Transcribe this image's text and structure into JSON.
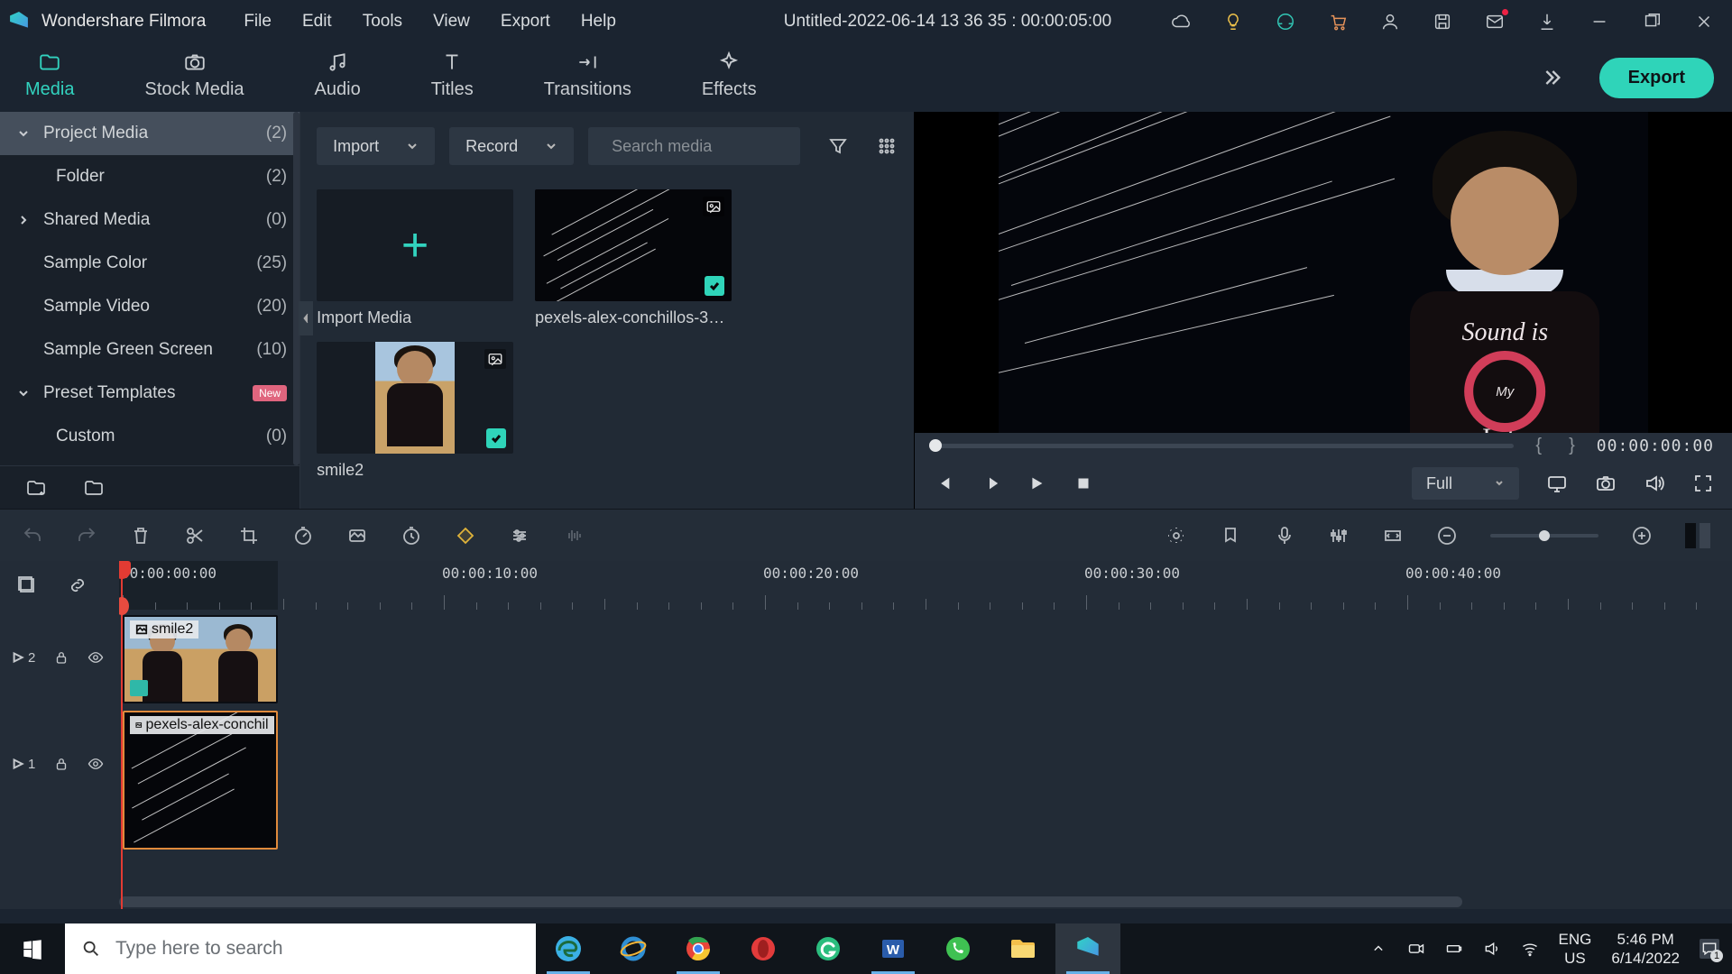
{
  "app": {
    "name": "Wondershare Filmora"
  },
  "menu": {
    "file": "File",
    "edit": "Edit",
    "tools": "Tools",
    "view": "View",
    "export": "Export",
    "help": "Help"
  },
  "title": "Untitled-2022-06-14 13 36 35 : 00:00:05:00",
  "modes": {
    "media": "Media",
    "stock": "Stock Media",
    "audio": "Audio",
    "titles": "Titles",
    "transitions": "Transitions",
    "effects": "Effects"
  },
  "export_btn": "Export",
  "sidebar": {
    "items": [
      {
        "label": "Project Media",
        "count": "(2)",
        "arrow": "down",
        "sel": true
      },
      {
        "label": "Folder",
        "count": "(2)",
        "indent": true
      },
      {
        "label": "Shared Media",
        "count": "(0)",
        "arrow": "right"
      },
      {
        "label": "Sample Color",
        "count": "(25)"
      },
      {
        "label": "Sample Video",
        "count": "(20)"
      },
      {
        "label": "Sample Green Screen",
        "count": "(10)"
      },
      {
        "label": "Preset Templates",
        "count": "",
        "arrow": "down",
        "new": true
      },
      {
        "label": "Custom",
        "count": "(0)",
        "indent": true
      }
    ],
    "new_badge": "New"
  },
  "midbar": {
    "import": "Import",
    "record": "Record",
    "search_ph": "Search media"
  },
  "media": {
    "import_label": "Import Media",
    "items": [
      {
        "label": "pexels-alex-conchillos-37…"
      },
      {
        "label": "smile2"
      }
    ]
  },
  "preview": {
    "timecode": "00:00:00:00",
    "quality": "Full",
    "shirt_line1": "Sound is",
    "shirt_ring": "My",
    "shirt_line2": "Life"
  },
  "timeline": {
    "ruler": [
      "00:00:00:00",
      "00:00:10:00",
      "00:00:20:00",
      "00:00:30:00",
      "00:00:40:00"
    ],
    "tracks": [
      {
        "num": "2"
      },
      {
        "num": "1"
      }
    ],
    "clips": [
      {
        "label": "smile2"
      },
      {
        "label": "pexels-alex-conchil"
      }
    ]
  },
  "taskbar": {
    "search_ph": "Type here to search",
    "lang1": "ENG",
    "lang2": "US",
    "time": "5:46 PM",
    "date": "6/14/2022",
    "notif": "1"
  }
}
